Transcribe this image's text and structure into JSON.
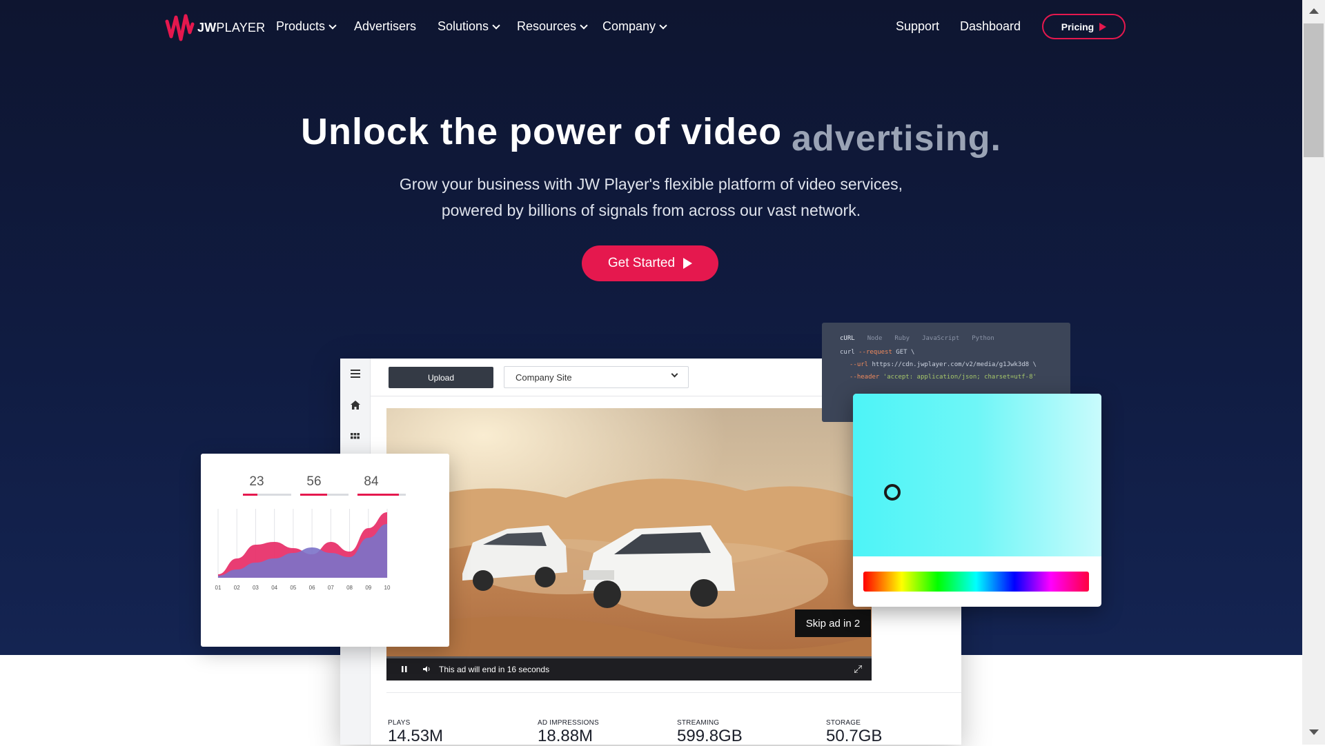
{
  "nav": {
    "logo_text_bold": "JW",
    "logo_text": "PLAYER",
    "products": "Products",
    "advertisers": "Advertisers",
    "solutions": "Solutions",
    "resources": "Resources",
    "company": "Company",
    "support": "Support",
    "dashboard": "Dashboard",
    "pricing": "Pricing"
  },
  "hero": {
    "headline": "Unlock the power of video",
    "headline_accent": "advertising.",
    "subtitle_line1": "Grow your business with JW Player's flexible platform of video services,",
    "subtitle_line2": "powered by billions of signals from across our vast network.",
    "cta": "Get Started"
  },
  "dashboard": {
    "upload_label": "Upload",
    "site_select_value": "Company Site",
    "side_icons": [
      "menu-icon",
      "home-icon",
      "grid-icon"
    ],
    "player": {
      "skip_ad": "Skip ad in 2",
      "ad_message": "This ad will end in 16 seconds"
    },
    "stats": [
      {
        "label": "PLAYS",
        "value": "14.53M"
      },
      {
        "label": "AD IMPRESSIONS",
        "value": "18.88M"
      },
      {
        "label": "STREAMING",
        "value": "599.8GB"
      },
      {
        "label": "STORAGE",
        "value": "50.7GB"
      }
    ]
  },
  "code_card": {
    "tabs": [
      "cURL",
      "Node",
      "Ruby",
      "JavaScript",
      "Python"
    ],
    "active_tab": "cURL",
    "line1_cmd": "curl",
    "line1_flag": "--request",
    "line1_rest": " GET \\",
    "line2_flag": "--url",
    "line2_rest": " https://cdn.jwplayer.com/v2/media/g1Jwk3d8 \\",
    "line3_flag": "--header",
    "line3_str": " 'accept: application/json; charset=utf-8'"
  },
  "color_picker": {
    "selected_color": "#4df4f7"
  },
  "chart_data": {
    "type": "area",
    "metrics": [
      {
        "value": "23",
        "fill": 0.3
      },
      {
        "value": "56",
        "fill": 0.55
      },
      {
        "value": "84",
        "fill": 0.85
      }
    ],
    "categories": [
      "01",
      "02",
      "03",
      "04",
      "05",
      "06",
      "07",
      "08",
      "09",
      "10"
    ],
    "series": [
      {
        "color": "#e8336b",
        "values": [
          5,
          28,
          48,
          52,
          43,
          34,
          52,
          38,
          72,
          95
        ]
      },
      {
        "color": "#7b72c9",
        "values": [
          3,
          12,
          22,
          28,
          36,
          44,
          36,
          30,
          58,
          78
        ]
      }
    ],
    "ylim": [
      0,
      100
    ]
  },
  "colors": {
    "brand": "#e5184e",
    "hero_bg": "#101c42"
  }
}
